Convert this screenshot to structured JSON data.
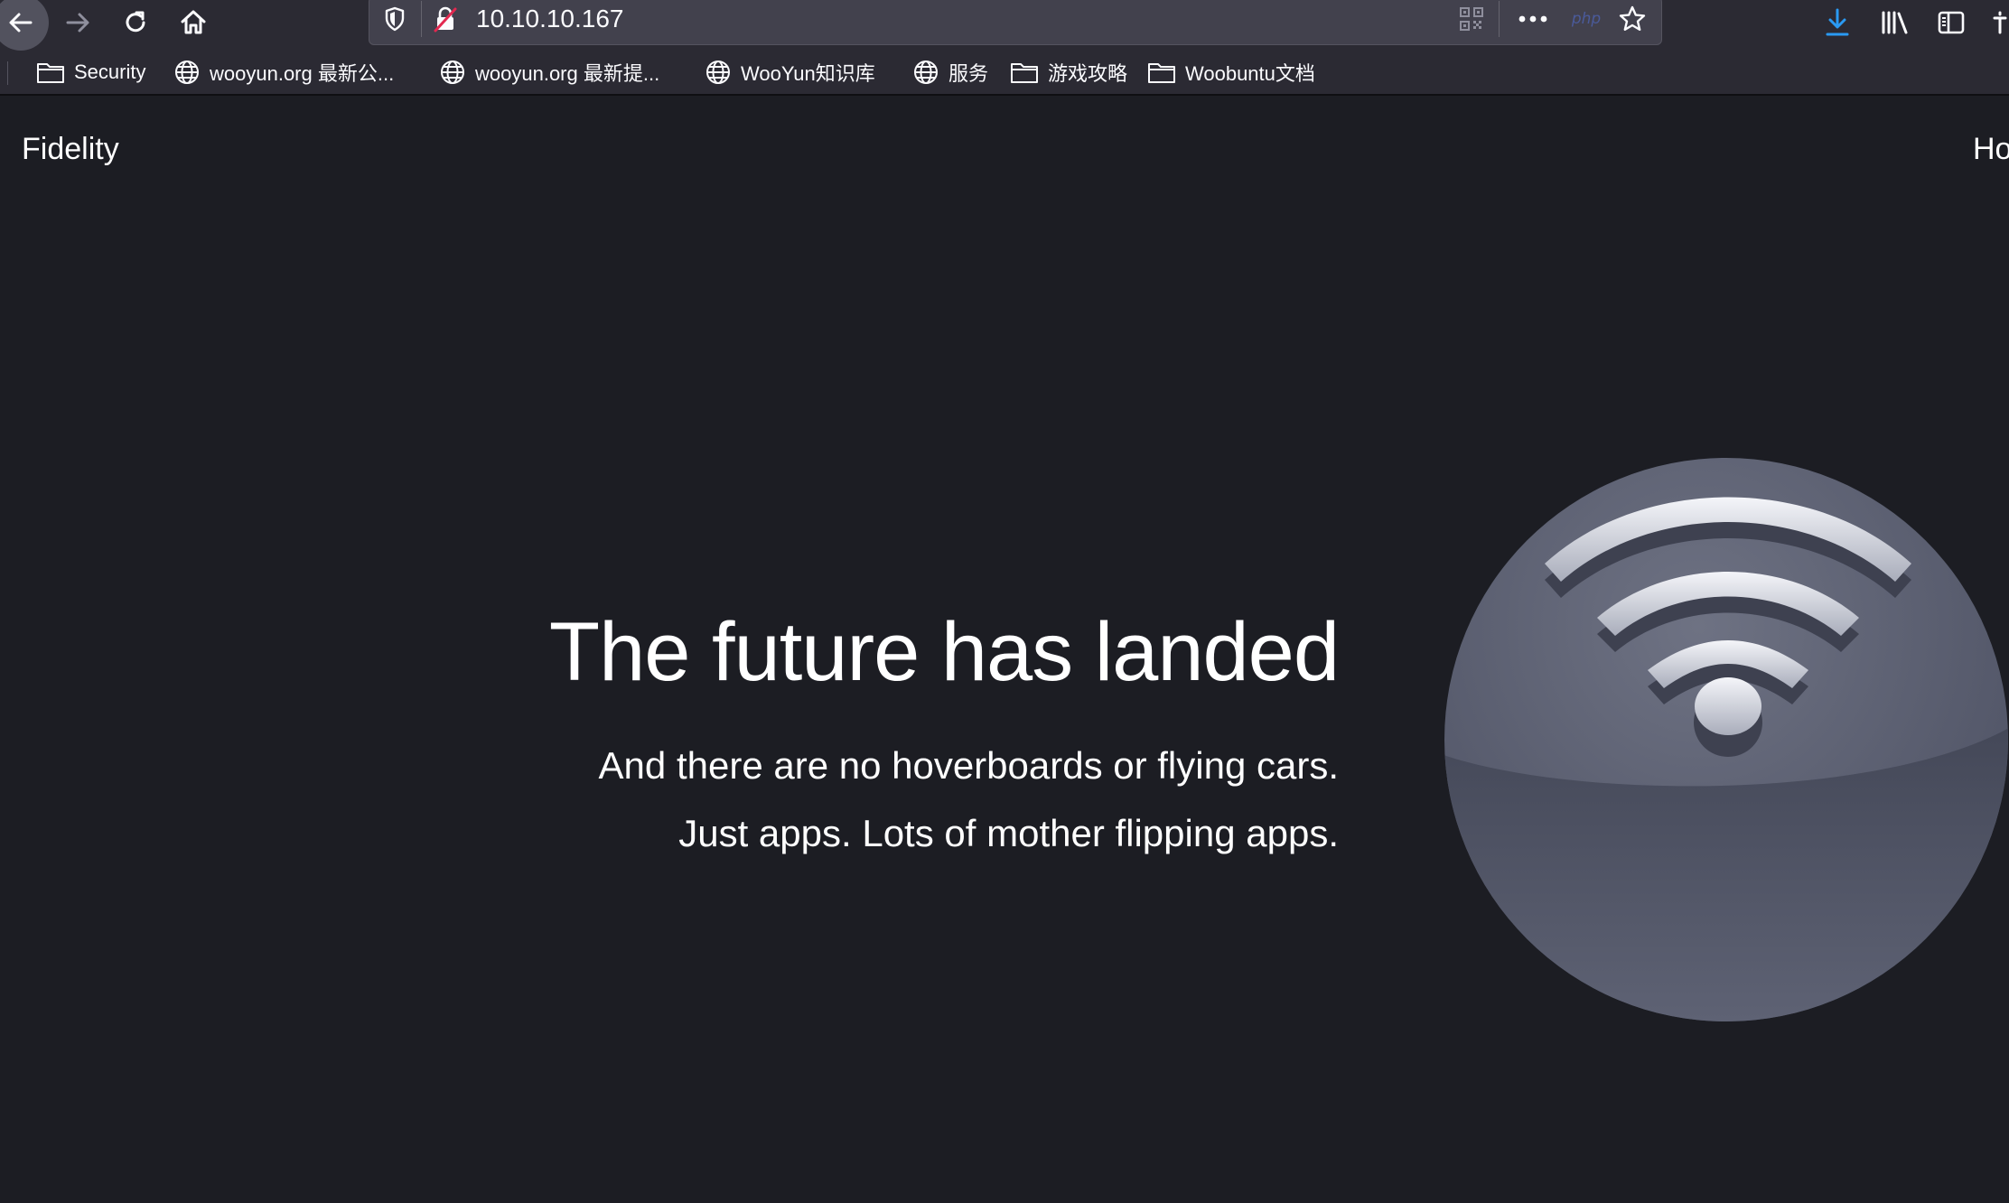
{
  "browser": {
    "url": "10.10.10.167",
    "php_badge": "php",
    "icons": {
      "back": "arrow-left-icon",
      "forward": "arrow-right-icon",
      "reload": "reload-icon",
      "home": "home-icon",
      "tracking": "shield-icon",
      "insecure": "insecure-lock-icon",
      "qr": "qr-code-icon",
      "more": "ellipsis-icon",
      "bookmark": "star-icon",
      "downloads": "download-icon",
      "library": "library-icon",
      "sidebar": "sidebar-icon"
    },
    "colors": {
      "toolbar": "#2b2a33",
      "urlbar": "#42414d",
      "download_accent": "#2a9af3"
    }
  },
  "bookmarks": [
    {
      "label": "Security",
      "icon": "folder-icon"
    },
    {
      "label": "wooyun.org 最新公...",
      "icon": "globe-icon"
    },
    {
      "label": "wooyun.org 最新提...",
      "icon": "globe-icon"
    },
    {
      "label": "WooYun知识库",
      "icon": "globe-icon"
    },
    {
      "label": "服务",
      "icon": "globe-icon"
    },
    {
      "label": "游戏攻略",
      "icon": "folder-icon"
    },
    {
      "label": "Woobuntu文档",
      "icon": "folder-icon"
    }
  ],
  "site": {
    "brand": "Fidelity",
    "nav_partial": "Ho",
    "hero": {
      "title": "The future has landed",
      "line1": "And there are no hoverboards or flying cars.",
      "line2": "Just apps. Lots of mother flipping apps."
    },
    "hero_image_icon": "wifi-sphere-icon",
    "background": "#1c1d23"
  }
}
